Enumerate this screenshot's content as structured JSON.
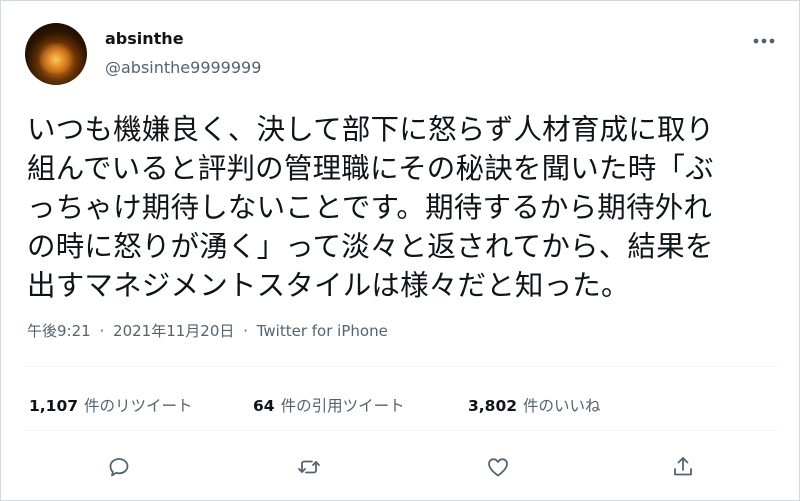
{
  "user": {
    "display_name": "absinthe",
    "handle": "@absinthe9999999"
  },
  "tweet": {
    "lines": [
      "いつも機嫌良く、決して部下に怒らず人材育成に取り",
      "組んでいると評判の管理職にその秘訣を聞いた時「ぶ",
      "っちゃけ期待しないことです。期待するから期待外れ",
      "の時に怒りが湧く」って淡々と返されてから、結果を",
      "出すマネジメントスタイルは様々だと知った。"
    ]
  },
  "meta": {
    "time": "午後9:21",
    "separator": "·",
    "date": "2021年11月20日",
    "source": "Twitter for iPhone"
  },
  "stats": {
    "retweets": {
      "count": "1,107",
      "label": "件のリツイート"
    },
    "quotes": {
      "count": "64",
      "label": "件の引用ツイート"
    },
    "likes": {
      "count": "3,802",
      "label": "件のいいね"
    }
  },
  "icons": {
    "more": "more-horizontal-icon",
    "reply": "reply-icon",
    "retweet": "retweet-icon",
    "like": "like-icon",
    "share": "share-icon"
  },
  "colors": {
    "text": "#0f1419",
    "secondary": "#536471",
    "divider": "#eff3f4"
  }
}
